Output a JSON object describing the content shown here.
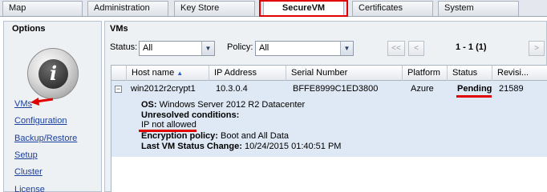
{
  "tabs": [
    {
      "label": "Map"
    },
    {
      "label": "Administration"
    },
    {
      "label": "Key Store"
    },
    {
      "label": "SecureVM"
    },
    {
      "label": "Certificates"
    },
    {
      "label": "System"
    }
  ],
  "left": {
    "title": "Options",
    "info_glyph": "i",
    "nav": [
      "VMs",
      "Configuration",
      "Backup/Restore",
      "Setup",
      "Cluster",
      "License"
    ]
  },
  "main": {
    "title": "VMs",
    "status_label": "Status:",
    "status_value": "All",
    "policy_label": "Policy:",
    "policy_value": "All",
    "pager": {
      "first": "<<",
      "prev": "<",
      "next": ">",
      "info": "1 - 1 (1)"
    },
    "columns": [
      "Host name",
      "IP Address",
      "Serial Number",
      "Platform",
      "Status",
      "Revisi..."
    ],
    "row": {
      "expander": "−",
      "host": "win2012r2crypt1",
      "ip": "10.3.0.4",
      "serial": "BFFE8999C1ED3800",
      "platform": "Azure",
      "status": "Pending",
      "revision": "21589"
    },
    "details": {
      "os_label": "OS:",
      "os_value": "Windows Server 2012 R2 Datacenter",
      "unresolved_label": "Unresolved conditions:",
      "unresolved_value": "IP not allowed",
      "policy_label": "Encryption policy:",
      "policy_value": "Boot and All Data",
      "last_change_label": "Last VM Status Change:",
      "last_change_value": "10/24/2015 01:40:51 PM"
    }
  },
  "colors": {
    "highlight": "#e00000",
    "link": "#1a3f9c",
    "detail_bg": "#dfe8f5"
  }
}
